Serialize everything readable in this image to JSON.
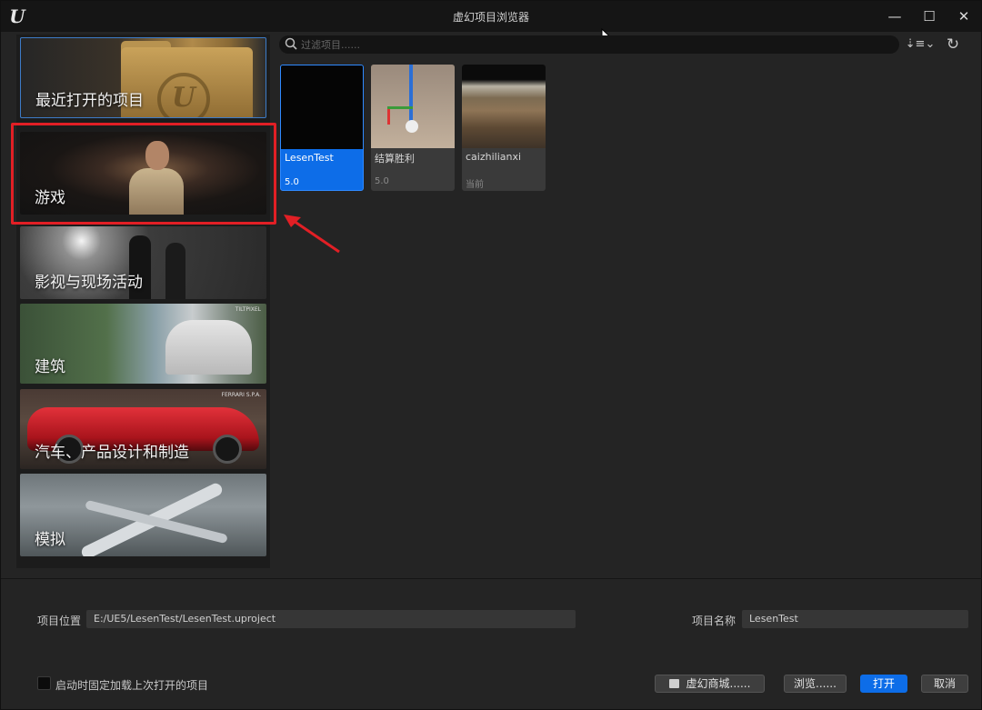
{
  "window": {
    "title": "虚幻项目浏览器",
    "logo_icon": "unreal-logo-icon",
    "minimize": "—",
    "maximize": "☐",
    "close": "✕"
  },
  "categories": [
    {
      "label": "最近打开的项目",
      "selected": true
    },
    {
      "label": "游戏"
    },
    {
      "label": "影视与现场活动"
    },
    {
      "label": "建筑",
      "watermark": "TILTPIXEL"
    },
    {
      "label": "汽车、产品设计和制造",
      "watermark": "FERRARI S.P.A."
    },
    {
      "label": "模拟"
    }
  ],
  "search": {
    "placeholder": "过滤项目......"
  },
  "toolbar": {
    "sort_icon": "sort-icon",
    "sort_glyph": "⇣≡⌄",
    "refresh_icon": "refresh-icon",
    "refresh_glyph": "↻"
  },
  "projects": [
    {
      "name": "LesenTest",
      "version": "5.0",
      "selected": true
    },
    {
      "name": "结算胜利",
      "version": "5.0"
    },
    {
      "name": "caizhilianxi",
      "version": "当前"
    }
  ],
  "footer": {
    "location_label": "项目位置",
    "location_value": "E:/UE5/LesenTest/LesenTest.uproject",
    "name_label": "项目名称",
    "name_value": "LesenTest",
    "startup_checkbox_label": "启动时固定加载上次打开的项目",
    "store_button": "虚幻商城......",
    "browse_button": "浏览......",
    "open_button": "打开",
    "cancel_button": "取消"
  },
  "colors": {
    "accent": "#0d6de8",
    "highlight_annotation": "#e21f25"
  }
}
